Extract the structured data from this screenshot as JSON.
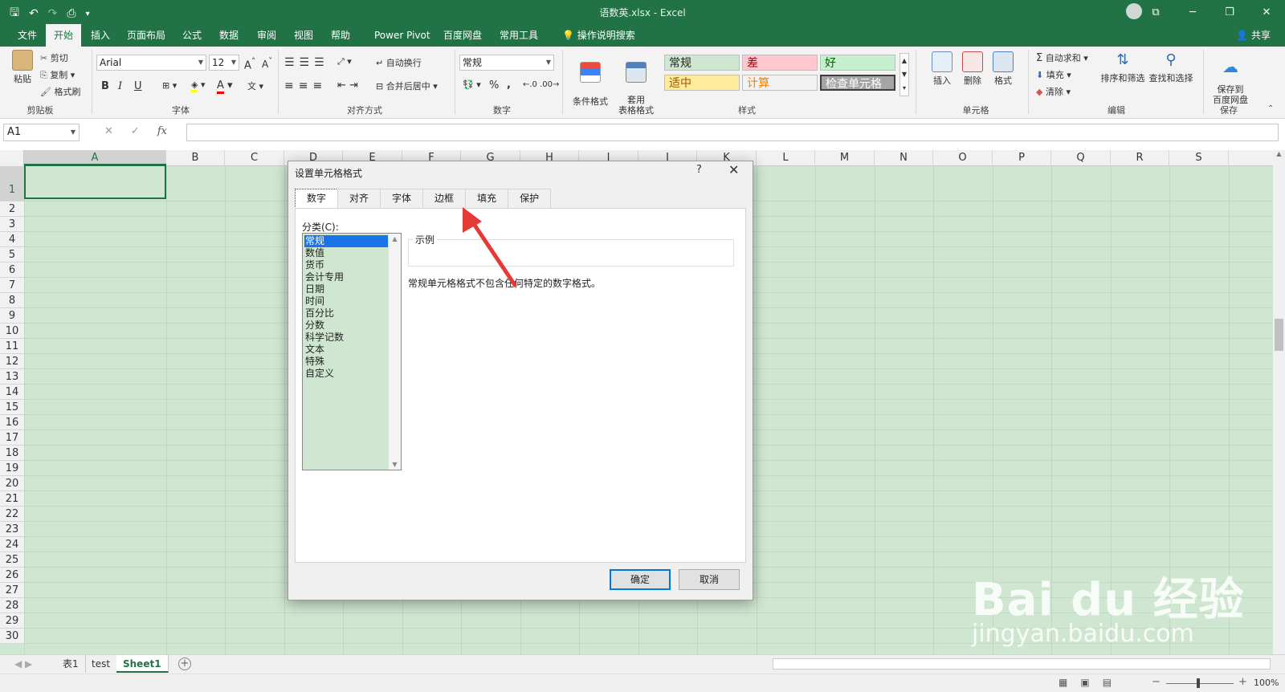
{
  "window": {
    "title": "语数英.xlsx - Excel"
  },
  "menu": {
    "tabs": [
      "文件",
      "开始",
      "插入",
      "页面布局",
      "公式",
      "数据",
      "审阅",
      "视图",
      "帮助",
      "Power Pivot",
      "百度网盘",
      "常用工具"
    ],
    "search": "操作说明搜索",
    "share": "共享"
  },
  "ribbon": {
    "clipboard": {
      "paste": "粘贴",
      "cut": "剪切",
      "copy": "复制",
      "format_painter": "格式刷",
      "label": "剪贴板"
    },
    "font": {
      "name": "Arial",
      "size": "12",
      "label": "字体",
      "bold": "B",
      "italic": "I",
      "underline": "U"
    },
    "alignment": {
      "wrap": "自动换行",
      "merge": "合并后居中",
      "label": "对齐方式"
    },
    "number": {
      "format": "常规",
      "percent": "%",
      "comma": ",",
      "label": "数字"
    },
    "styles": {
      "conditional": "条件格式",
      "table": "套用\n表格格式",
      "cells": [
        {
          "text": "常规",
          "bg": "#cfe7d1",
          "fg": "#222222"
        },
        {
          "text": "差",
          "bg": "#ffc7ce",
          "fg": "#9c0006"
        },
        {
          "text": "好",
          "bg": "#c6efce",
          "fg": "#006100"
        },
        {
          "text": "适中",
          "bg": "#ffeb9c",
          "fg": "#9c5700"
        },
        {
          "text": "计算",
          "bg": "#f2f2f2",
          "fg": "#fa7d00"
        },
        {
          "text": "检查单元格",
          "bg": "#a5a5a5",
          "fg": "#ffffff"
        }
      ],
      "label": "样式"
    },
    "cells": {
      "insert": "插入",
      "delete": "删除",
      "format": "格式",
      "label": "单元格"
    },
    "editing": {
      "autosum": "自动求和",
      "fill": "填充",
      "clear": "清除",
      "sort": "排序和筛选",
      "find": "查找和选择",
      "label": "编辑"
    },
    "save": {
      "button": "保存到\n百度网盘",
      "label": "保存"
    }
  },
  "formula_bar": {
    "name_box": "A1",
    "fx": "fx",
    "value": ""
  },
  "grid": {
    "columns": [
      "A",
      "B",
      "C",
      "D",
      "E",
      "F",
      "G",
      "H",
      "I",
      "J",
      "K",
      "L",
      "M",
      "N",
      "O",
      "P",
      "Q",
      "R",
      "S"
    ],
    "rows": [
      "1",
      "2",
      "3",
      "4",
      "5",
      "6",
      "7",
      "8",
      "9",
      "10",
      "11",
      "12",
      "13",
      "14",
      "15",
      "16",
      "17",
      "18",
      "19",
      "20",
      "21",
      "22",
      "23",
      "24",
      "25",
      "26",
      "27",
      "28",
      "29",
      "30"
    ],
    "selected_cell": "A1"
  },
  "dialog": {
    "title": "设置单元格格式",
    "help": "?",
    "close": "✕",
    "tabs": [
      "数字",
      "对齐",
      "字体",
      "边框",
      "填充",
      "保护"
    ],
    "active_tab": "数字",
    "category_label": "分类(C):",
    "categories": [
      "常规",
      "数值",
      "货币",
      "会计专用",
      "日期",
      "时间",
      "百分比",
      "分数",
      "科学记数",
      "文本",
      "特殊",
      "自定义"
    ],
    "selected_category": "常规",
    "sample_label": "示例",
    "description": "常规单元格格式不包含任何特定的数字格式。",
    "ok": "确定",
    "cancel": "取消"
  },
  "sheets": {
    "tabs": [
      "表1",
      "test",
      "Sheet1"
    ],
    "active": "Sheet1"
  },
  "status": {
    "zoom": "100%"
  },
  "watermark": {
    "brand": "Bai du 经验",
    "url": "jingyan.baidu.com"
  },
  "colors": {
    "excel_green": "#217346",
    "grid_bg": "#cfe7d1",
    "arrow": "#e53935",
    "selection_blue": "#1a73e8"
  }
}
